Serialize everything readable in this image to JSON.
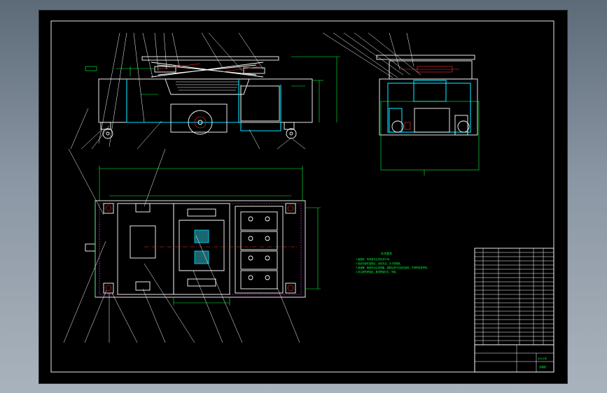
{
  "drawing": {
    "background": "#000000",
    "colors": {
      "outline": "#ffffff",
      "frame": "#00e1ff",
      "dimension": "#00ff3c",
      "hidden": "#ff40ff",
      "accent": "#ff3030"
    },
    "technical_requirements_title": "技术要求",
    "technical_requirements_lines": [
      "1.装配前，所有零件必须清洗干净。",
      "2.各运动部件装配后，运动灵活，无卡滞现象。",
      "3.减速器、轴承内加注润滑脂，装配后进行空载试运转，不得有异常声响。",
      "4.未注明的焊接处，要求焊缝均匀、牢固。"
    ],
    "title_block": {
      "drawing_name": "AGV小车",
      "drawing_number": "总装图"
    }
  }
}
